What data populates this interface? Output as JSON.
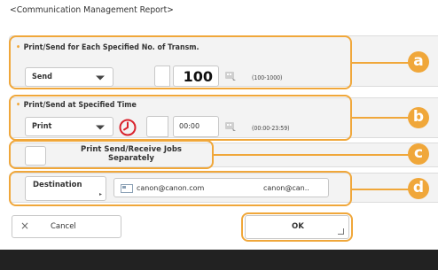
{
  "title": "<Communication Management Report>",
  "section_transm": {
    "label": "Print/Send for Each Specified No. of Transm.",
    "dropdown_value": "Send",
    "number_value": "100",
    "range": "(100-1000)"
  },
  "section_time": {
    "label": "Print/Send at Specified Time",
    "dropdown_value": "Print",
    "time_value": "00:00",
    "range": "(00:00-23:59)"
  },
  "separately": {
    "label_line1": "Print Send/Receive Jobs",
    "label_line2": "Separately"
  },
  "destination": {
    "button_label": "Destination",
    "email": "canon@canon.com",
    "name": "canon@can.."
  },
  "footer": {
    "cancel_label": "Cancel",
    "ok_label": "OK"
  },
  "callouts": [
    "a",
    "b",
    "c",
    "d"
  ],
  "colors": {
    "accent": "#f0a73a",
    "clock": "#d9232d",
    "bottom_bar": "#222222"
  },
  "icons": [
    "keyboard-icon",
    "clock-icon",
    "close-icon",
    "address-card-icon"
  ]
}
